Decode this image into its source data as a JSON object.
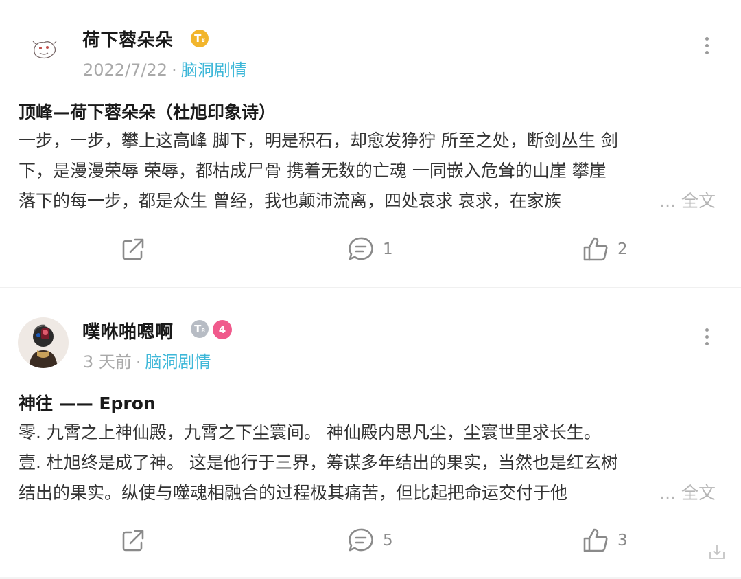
{
  "posts": [
    {
      "author": "荷下蓉朵朵",
      "badge_level": "T",
      "badge_level_sub": "8",
      "date": "2022/7/22",
      "separator": "·",
      "topic": "脑洞剧情",
      "title": "顶峰—荷下蓉朵朵（杜旭印象诗）",
      "lines": [
        "一步，一步，攀上这高峰 脚下，明是积石，却愈发狰狞 所至之处，断剑丛生 剑",
        "下，是漫漫荣辱 荣辱，都枯成尸骨 携着无数的亡魂 一同嵌入危耸的山崖 攀崖",
        "落下的每一步，都是众生 曾经，我也颠沛流离，四处哀求 哀求，在家族"
      ],
      "more_label": "... 全文",
      "comments": "1",
      "likes": "2"
    },
    {
      "author": "噗咻啪嗯啊",
      "badge_level": "T",
      "badge_level_sub": "8",
      "badge_num": "4",
      "date": "3 天前",
      "separator": "·",
      "topic": "脑洞剧情",
      "title": "神往 —— Epron",
      "lines": [
        "零. 九霄之上神仙殿，九霄之下尘寰间。 神仙殿内思凡尘，尘寰世里求长生。",
        "壹. 杜旭终是成了神。 这是他行于三界，筹谋多年结出的果实，当然也是红玄树",
        "结出的果实。纵使与噬魂相融合的过程极其痛苦，但比起把命运交付于他"
      ],
      "more_label": "... 全文",
      "comments": "5",
      "likes": "3"
    }
  ],
  "colors": {
    "topic": "#3db7d8",
    "meta": "#a9a9a9",
    "icon": "#8a8a8a",
    "badge_gold": "#f2b52c",
    "badge_pink": "#f05a8c"
  },
  "icons": [
    "share-icon",
    "comment-icon",
    "like-icon",
    "more-options-icon",
    "export-icon"
  ]
}
